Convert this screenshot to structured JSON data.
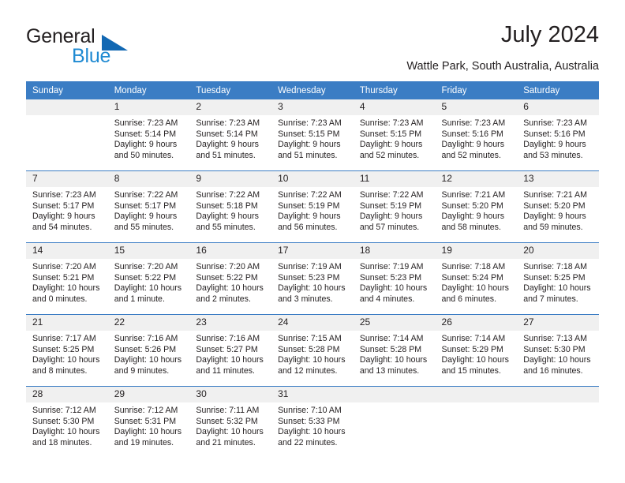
{
  "brand": {
    "name_part1": "General",
    "name_part2": "Blue",
    "triangle_color": "#1268b3",
    "blue_color": "#1f8ad2"
  },
  "header": {
    "title": "July 2024",
    "subtitle": "Wattle Park, South Australia, Australia",
    "header_bg": "#3b7dc4",
    "daynum_bg": "#f0f0f0"
  },
  "calendar": {
    "weekday_headers": [
      "Sunday",
      "Monday",
      "Tuesday",
      "Wednesday",
      "Thursday",
      "Friday",
      "Saturday"
    ],
    "labels": {
      "sunrise": "Sunrise:",
      "sunset": "Sunset:",
      "daylight": "Daylight:"
    },
    "weeks": [
      [
        {
          "day": "",
          "blank": true
        },
        {
          "day": "1",
          "sunrise": "Sunrise: 7:23 AM",
          "sunset": "Sunset: 5:14 PM",
          "daylight1": "Daylight: 9 hours",
          "daylight2": "and 50 minutes."
        },
        {
          "day": "2",
          "sunrise": "Sunrise: 7:23 AM",
          "sunset": "Sunset: 5:14 PM",
          "daylight1": "Daylight: 9 hours",
          "daylight2": "and 51 minutes."
        },
        {
          "day": "3",
          "sunrise": "Sunrise: 7:23 AM",
          "sunset": "Sunset: 5:15 PM",
          "daylight1": "Daylight: 9 hours",
          "daylight2": "and 51 minutes."
        },
        {
          "day": "4",
          "sunrise": "Sunrise: 7:23 AM",
          "sunset": "Sunset: 5:15 PM",
          "daylight1": "Daylight: 9 hours",
          "daylight2": "and 52 minutes."
        },
        {
          "day": "5",
          "sunrise": "Sunrise: 7:23 AM",
          "sunset": "Sunset: 5:16 PM",
          "daylight1": "Daylight: 9 hours",
          "daylight2": "and 52 minutes."
        },
        {
          "day": "6",
          "sunrise": "Sunrise: 7:23 AM",
          "sunset": "Sunset: 5:16 PM",
          "daylight1": "Daylight: 9 hours",
          "daylight2": "and 53 minutes."
        }
      ],
      [
        {
          "day": "7",
          "sunrise": "Sunrise: 7:23 AM",
          "sunset": "Sunset: 5:17 PM",
          "daylight1": "Daylight: 9 hours",
          "daylight2": "and 54 minutes."
        },
        {
          "day": "8",
          "sunrise": "Sunrise: 7:22 AM",
          "sunset": "Sunset: 5:17 PM",
          "daylight1": "Daylight: 9 hours",
          "daylight2": "and 55 minutes."
        },
        {
          "day": "9",
          "sunrise": "Sunrise: 7:22 AM",
          "sunset": "Sunset: 5:18 PM",
          "daylight1": "Daylight: 9 hours",
          "daylight2": "and 55 minutes."
        },
        {
          "day": "10",
          "sunrise": "Sunrise: 7:22 AM",
          "sunset": "Sunset: 5:19 PM",
          "daylight1": "Daylight: 9 hours",
          "daylight2": "and 56 minutes."
        },
        {
          "day": "11",
          "sunrise": "Sunrise: 7:22 AM",
          "sunset": "Sunset: 5:19 PM",
          "daylight1": "Daylight: 9 hours",
          "daylight2": "and 57 minutes."
        },
        {
          "day": "12",
          "sunrise": "Sunrise: 7:21 AM",
          "sunset": "Sunset: 5:20 PM",
          "daylight1": "Daylight: 9 hours",
          "daylight2": "and 58 minutes."
        },
        {
          "day": "13",
          "sunrise": "Sunrise: 7:21 AM",
          "sunset": "Sunset: 5:20 PM",
          "daylight1": "Daylight: 9 hours",
          "daylight2": "and 59 minutes."
        }
      ],
      [
        {
          "day": "14",
          "sunrise": "Sunrise: 7:20 AM",
          "sunset": "Sunset: 5:21 PM",
          "daylight1": "Daylight: 10 hours",
          "daylight2": "and 0 minutes."
        },
        {
          "day": "15",
          "sunrise": "Sunrise: 7:20 AM",
          "sunset": "Sunset: 5:22 PM",
          "daylight1": "Daylight: 10 hours",
          "daylight2": "and 1 minute."
        },
        {
          "day": "16",
          "sunrise": "Sunrise: 7:20 AM",
          "sunset": "Sunset: 5:22 PM",
          "daylight1": "Daylight: 10 hours",
          "daylight2": "and 2 minutes."
        },
        {
          "day": "17",
          "sunrise": "Sunrise: 7:19 AM",
          "sunset": "Sunset: 5:23 PM",
          "daylight1": "Daylight: 10 hours",
          "daylight2": "and 3 minutes."
        },
        {
          "day": "18",
          "sunrise": "Sunrise: 7:19 AM",
          "sunset": "Sunset: 5:23 PM",
          "daylight1": "Daylight: 10 hours",
          "daylight2": "and 4 minutes."
        },
        {
          "day": "19",
          "sunrise": "Sunrise: 7:18 AM",
          "sunset": "Sunset: 5:24 PM",
          "daylight1": "Daylight: 10 hours",
          "daylight2": "and 6 minutes."
        },
        {
          "day": "20",
          "sunrise": "Sunrise: 7:18 AM",
          "sunset": "Sunset: 5:25 PM",
          "daylight1": "Daylight: 10 hours",
          "daylight2": "and 7 minutes."
        }
      ],
      [
        {
          "day": "21",
          "sunrise": "Sunrise: 7:17 AM",
          "sunset": "Sunset: 5:25 PM",
          "daylight1": "Daylight: 10 hours",
          "daylight2": "and 8 minutes."
        },
        {
          "day": "22",
          "sunrise": "Sunrise: 7:16 AM",
          "sunset": "Sunset: 5:26 PM",
          "daylight1": "Daylight: 10 hours",
          "daylight2": "and 9 minutes."
        },
        {
          "day": "23",
          "sunrise": "Sunrise: 7:16 AM",
          "sunset": "Sunset: 5:27 PM",
          "daylight1": "Daylight: 10 hours",
          "daylight2": "and 11 minutes."
        },
        {
          "day": "24",
          "sunrise": "Sunrise: 7:15 AM",
          "sunset": "Sunset: 5:28 PM",
          "daylight1": "Daylight: 10 hours",
          "daylight2": "and 12 minutes."
        },
        {
          "day": "25",
          "sunrise": "Sunrise: 7:14 AM",
          "sunset": "Sunset: 5:28 PM",
          "daylight1": "Daylight: 10 hours",
          "daylight2": "and 13 minutes."
        },
        {
          "day": "26",
          "sunrise": "Sunrise: 7:14 AM",
          "sunset": "Sunset: 5:29 PM",
          "daylight1": "Daylight: 10 hours",
          "daylight2": "and 15 minutes."
        },
        {
          "day": "27",
          "sunrise": "Sunrise: 7:13 AM",
          "sunset": "Sunset: 5:30 PM",
          "daylight1": "Daylight: 10 hours",
          "daylight2": "and 16 minutes."
        }
      ],
      [
        {
          "day": "28",
          "sunrise": "Sunrise: 7:12 AM",
          "sunset": "Sunset: 5:30 PM",
          "daylight1": "Daylight: 10 hours",
          "daylight2": "and 18 minutes."
        },
        {
          "day": "29",
          "sunrise": "Sunrise: 7:12 AM",
          "sunset": "Sunset: 5:31 PM",
          "daylight1": "Daylight: 10 hours",
          "daylight2": "and 19 minutes."
        },
        {
          "day": "30",
          "sunrise": "Sunrise: 7:11 AM",
          "sunset": "Sunset: 5:32 PM",
          "daylight1": "Daylight: 10 hours",
          "daylight2": "and 21 minutes."
        },
        {
          "day": "31",
          "sunrise": "Sunrise: 7:10 AM",
          "sunset": "Sunset: 5:33 PM",
          "daylight1": "Daylight: 10 hours",
          "daylight2": "and 22 minutes."
        },
        {
          "day": "",
          "blank": true
        },
        {
          "day": "",
          "blank": true
        },
        {
          "day": "",
          "blank": true
        }
      ]
    ]
  }
}
